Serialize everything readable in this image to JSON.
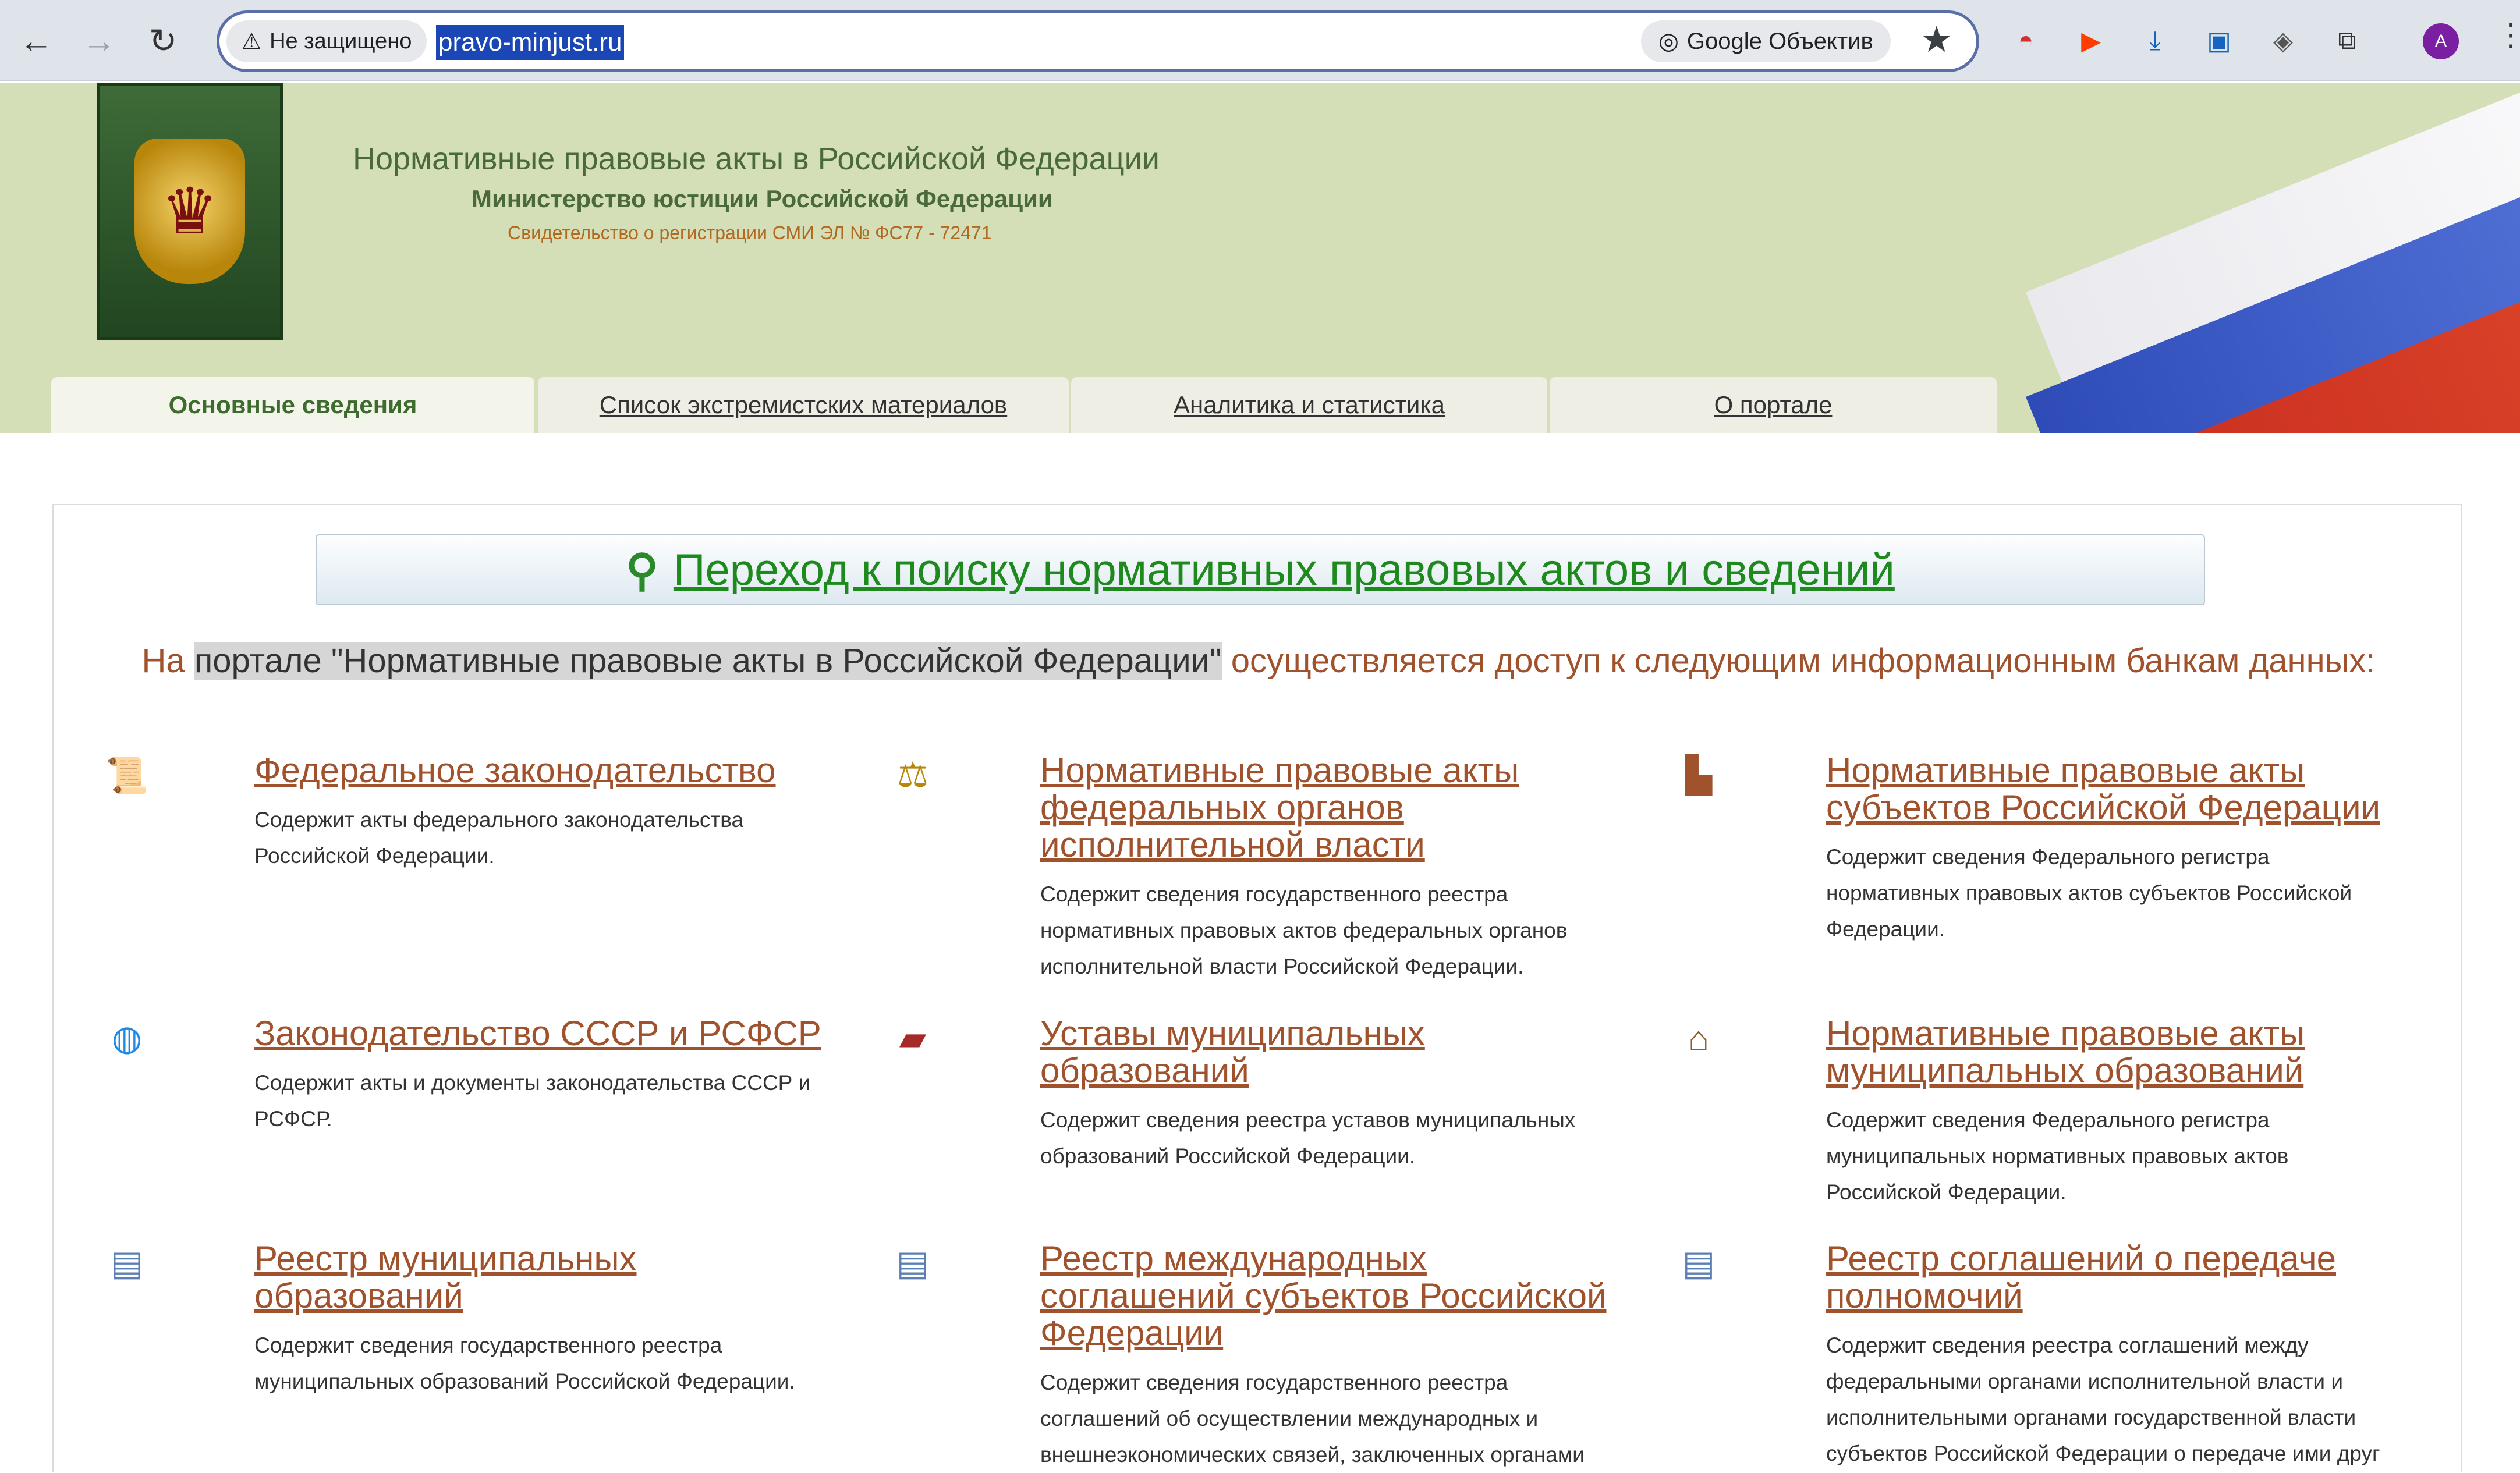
{
  "browser": {
    "security_label": "Не защищено",
    "url": "pravo-minjust.ru",
    "lens_label": "Google Объектив",
    "avatar_letter": "A"
  },
  "header": {
    "title": "Нормативные правовые акты в Российской Федерации",
    "subtitle": "Министерство юстиции Российской Федерации",
    "certificate": "Свидетельство о регистрации СМИ ЭЛ № ФС77 - 72471"
  },
  "tabs": [
    "Основные сведения",
    "Список экстремистских материалов",
    "Аналитика и статистика",
    "О портале"
  ],
  "search_link": "Переход к поиску нормативных правовых актов и сведений",
  "intro": {
    "before": "На ",
    "highlight": "портале \"Нормативные правовые акты в Российской Федерации\"",
    "after": " осуществляется доступ к следующим информационным банкам данных:"
  },
  "items": [
    {
      "title": "Федеральное законодательство",
      "desc": "Содержит акты федерального законодательства Российской Федерации.",
      "icon": "emblem-doc-icon"
    },
    {
      "title": "Нормативные правовые акты федеральных органов исполнительной власти",
      "desc": "Содержит сведения государственного реестра нормативных правовых актов федеральных органов исполнительной власти Российской Федерации.",
      "icon": "scales-icon"
    },
    {
      "title": "Нормативные правовые акты субъектов Российской Федерации",
      "desc": "Содержит сведения Федерального регистра нормативных правовых актов субъектов Российской Федерации.",
      "icon": "stamp-icon"
    },
    {
      "title": "Законодательство СССР и РСФСР",
      "desc": "Содержит акты и документы законодательства СССР и РСФСР.",
      "icon": "globe-icon"
    },
    {
      "title": "Уставы муниципальных образований",
      "desc": "Содержит сведения реестра уставов муниципальных образований Российской Федерации.",
      "icon": "book-icon"
    },
    {
      "title": "Нормативные правовые акты муниципальных образований",
      "desc": "Содержит сведения Федерального регистра муниципальных нормативных правовых актов Российской Федерации.",
      "icon": "house-icon"
    },
    {
      "title": "Реестр муниципальных образований",
      "desc": "Содержит сведения государственного реестра муниципальных образований Российской Федерации.",
      "icon": "document-icon"
    },
    {
      "title": "Реестр международных соглашений субъектов Российской Федерации",
      "desc": "Содержит сведения государственного реестра соглашений об осуществлении международных и внешнеэкономических связей, заключенных органами",
      "icon": "document-icon"
    },
    {
      "title": "Реестр соглашений о передаче полномочий",
      "desc": "Содержит сведения реестра соглашений между федеральными органами исполнительной власти и исполнительными органами государственной власти субъектов Российской Федерации о передаче ими друг",
      "icon": "document-icon"
    }
  ]
}
